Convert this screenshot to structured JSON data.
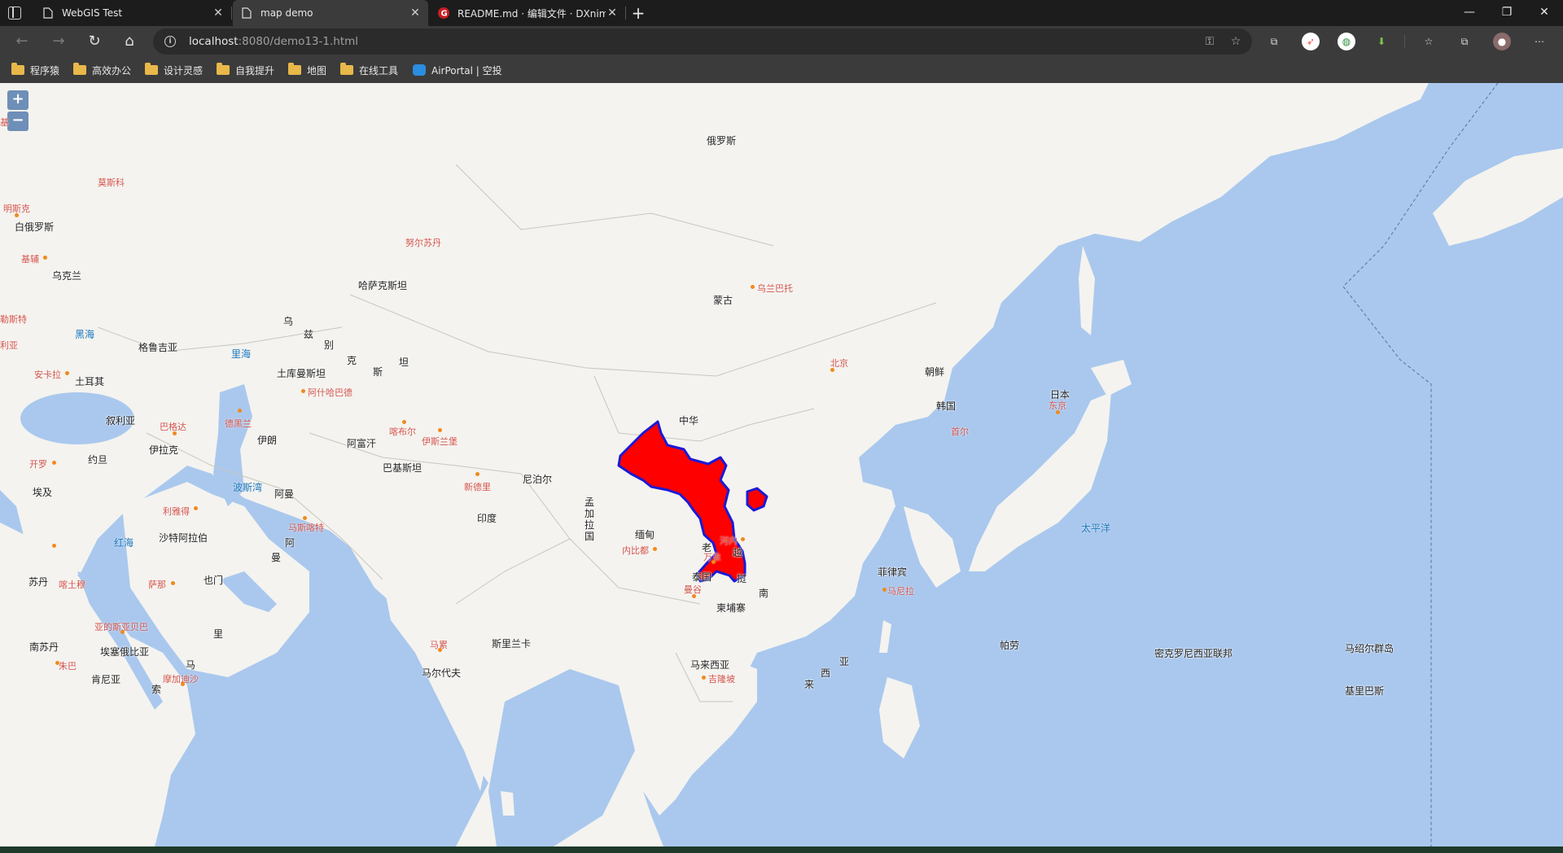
{
  "tabs": [
    {
      "label": "WebGIS Test",
      "icon": "page-icon",
      "active": false
    },
    {
      "label": "map demo",
      "icon": "page-icon",
      "active": true
    },
    {
      "label": "README.md · 编辑文件 · DXnima",
      "icon": "gitee-icon",
      "active": false
    }
  ],
  "window_controls": {
    "minimize": "—",
    "maximize": "❐",
    "close": "✕"
  },
  "address": {
    "host": "localhost",
    "rest": ":8080/demo13-1.html"
  },
  "bookmarks": [
    {
      "label": "程序猿",
      "icon": "folder-icon"
    },
    {
      "label": "高效办公",
      "icon": "folder-icon"
    },
    {
      "label": "设计灵感",
      "icon": "folder-icon"
    },
    {
      "label": "自我提升",
      "icon": "folder-icon"
    },
    {
      "label": "地图",
      "icon": "folder-icon"
    },
    {
      "label": "在线工具",
      "icon": "folder-icon"
    },
    {
      "label": "AirPortal | 空投",
      "icon": "airportal-icon"
    }
  ],
  "map": {
    "zoom_in": "+",
    "zoom_out": "−",
    "highlight_color": "#ff0000",
    "highlight_stroke": "#1a1ad6",
    "countries": [
      "俄罗斯",
      "白俄罗斯",
      "乌克兰",
      "哈萨克斯坦",
      "蒙古",
      "格鲁吉亚",
      "土耳其",
      "土库曼斯坦",
      "乌",
      "兹",
      "别",
      "克",
      "斯",
      "坦",
      "叙利亚",
      "伊拉克",
      "伊朗",
      "阿富汗",
      "巴基斯坦",
      "尼泊尔",
      "印度",
      "约旦",
      "埃及",
      "沙特阿拉伯",
      "阿曼",
      "阿",
      "曼",
      "也门",
      "苏丹",
      "南苏丹",
      "埃塞俄比亚",
      "肯尼亚",
      "里",
      "马",
      "索",
      "孟",
      "加",
      "拉",
      "国",
      "缅甸",
      "老",
      "越",
      "泰国",
      "挝",
      "南",
      "柬埔寨",
      "中华",
      "朝鲜",
      "韩国",
      "日本",
      "菲律宾",
      "马来西亚",
      "斯里兰卡",
      "马尔代夫",
      "帕劳",
      "密克罗尼西亚联邦",
      "马绍尔群岛",
      "亚",
      "西",
      "来",
      "基里巴斯"
    ],
    "cities": [
      "莫斯科",
      "明斯克",
      "基辅",
      "努尔苏丹",
      "乌兰巴托",
      "北京",
      "首尔",
      "东京",
      "安卡拉",
      "阿什哈巴德",
      "巴格达",
      "德黑兰",
      "喀布尔",
      "伊斯兰堡",
      "新德里",
      "开罗",
      "利雅得",
      "马斯喀特",
      "萨那",
      "喀土穆",
      "亚的斯亚贝巴",
      "朱巴",
      "摩加迪沙",
      "内比都",
      "河内",
      "万象",
      "曼谷",
      "马尼拉",
      "吉隆坡",
      "马累",
      "基",
      "勒斯特",
      "利亚"
    ],
    "seas": [
      "黑海",
      "里海",
      "波斯湾",
      "红海",
      "太平洋"
    ]
  }
}
